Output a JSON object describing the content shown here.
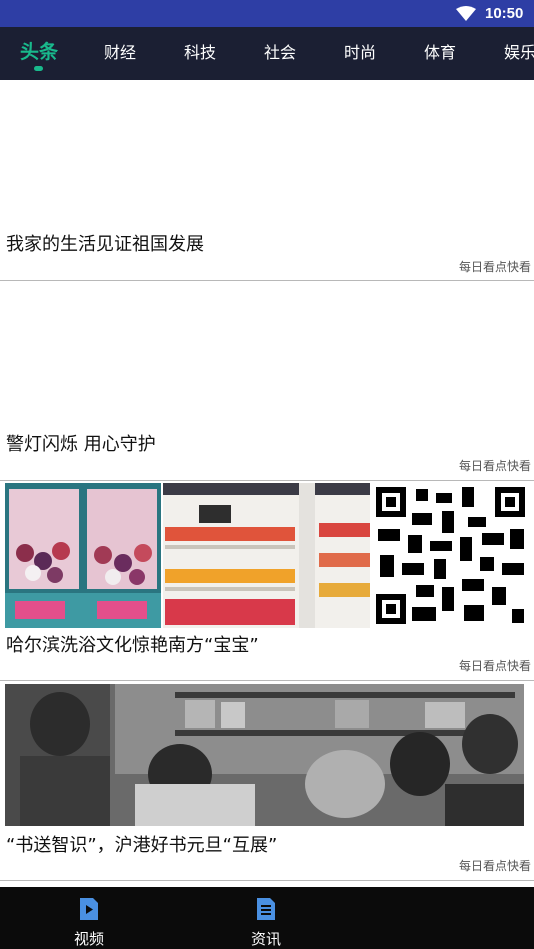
{
  "status_bar": {
    "time": "10:50"
  },
  "tabs": [
    {
      "label": "头条",
      "active": true
    },
    {
      "label": "财经"
    },
    {
      "label": "科技"
    },
    {
      "label": "社会"
    },
    {
      "label": "时尚"
    },
    {
      "label": "体育"
    },
    {
      "label": "娱乐"
    }
  ],
  "feed": [
    {
      "title": "我家的生活见证祖国发展",
      "source": "每日看点快看"
    },
    {
      "title": "警灯闪烁 用心守护",
      "source": "每日看点快看"
    },
    {
      "title": "哈尔滨洗浴文化惊艳南方“宝宝”",
      "source": "每日看点快看"
    },
    {
      "title": "“书送智识”，沪港好书元旦“互展”",
      "source": "每日看点快看"
    }
  ],
  "bottom_nav": [
    {
      "label": "视频",
      "icon": "video-icon"
    },
    {
      "label": "资讯",
      "icon": "news-icon"
    }
  ],
  "colors": {
    "status_bar": "#2e3ea5",
    "tab_bar": "#1b1f33",
    "accent": "#19b98c",
    "bottom_nav": "#0b0b0b",
    "nav_icon": "#4a90e2"
  }
}
